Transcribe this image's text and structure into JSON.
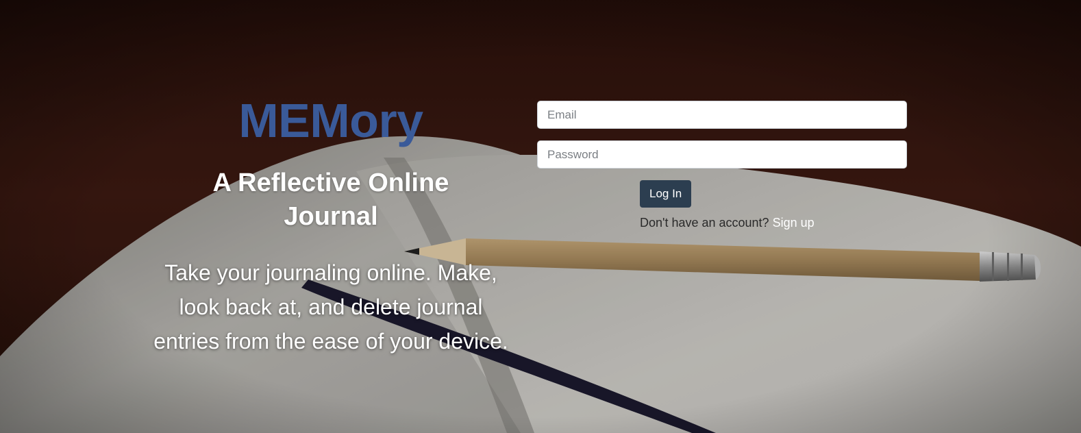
{
  "brand": {
    "name": "MEMory",
    "color": "#3a5a99"
  },
  "hero": {
    "tagline": "A Reflective Online Journal",
    "description": "Take your journaling online. Make, look back at, and delete journal entries from the ease of your device."
  },
  "login": {
    "email_placeholder": "Email",
    "email_value": "",
    "password_placeholder": "Password",
    "password_value": "",
    "submit_label": "Log In",
    "signup_prompt": "Don't have an account?",
    "signup_link": "Sign up"
  },
  "colors": {
    "button_bg": "#2c3e50",
    "link": "#ffffff"
  },
  "background_image": "notebook-with-pencil-photo"
}
